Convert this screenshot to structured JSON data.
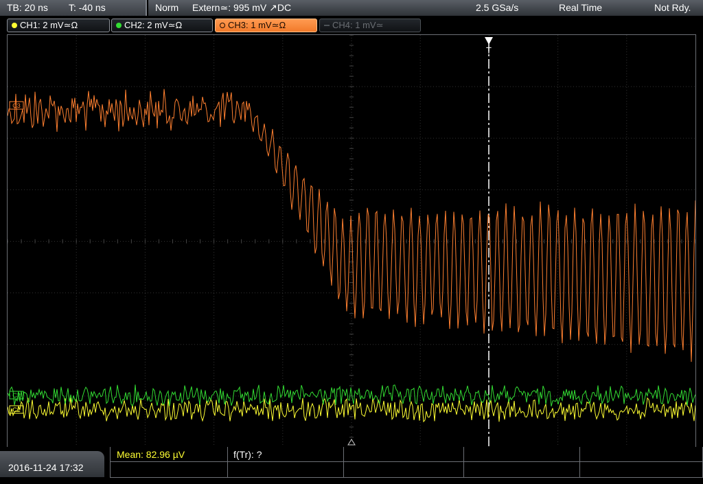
{
  "timebase": {
    "tb_label": "TB: 20 ns",
    "t_label": "T: -40 ns"
  },
  "status": {
    "mode": "Norm",
    "trigger": "Extern≃: 995 mV ↗DC",
    "sample_rate": "2.5 GSa/s",
    "acq": "Real Time",
    "ready": "Not Rdy."
  },
  "channels": [
    {
      "label": "CH1: 2 mV≃Ω",
      "color": "#ffff33",
      "state": "on"
    },
    {
      "label": "CH2: 2 mV≃Ω",
      "color": "#33dd33",
      "state": "on"
    },
    {
      "label": "CH3: 1 mV≃Ω",
      "color": "#ff8030",
      "state": "active"
    },
    {
      "label": "CH4: 1 mV≃",
      "color": "#6a6e73",
      "state": "off"
    }
  ],
  "markers": {
    "c3": "C3",
    "c2": "C2",
    "c1": "C1",
    "trigger": "T"
  },
  "measurement": {
    "mean": "Mean: 82.96 µV",
    "ftr": "f(Tr): ?"
  },
  "datetime": "2016-11-24 17:32",
  "colors": {
    "ch1": "#ffff33",
    "ch2": "#33dd33",
    "ch3": "#ff8030",
    "grid": "#3a3a3a"
  }
}
